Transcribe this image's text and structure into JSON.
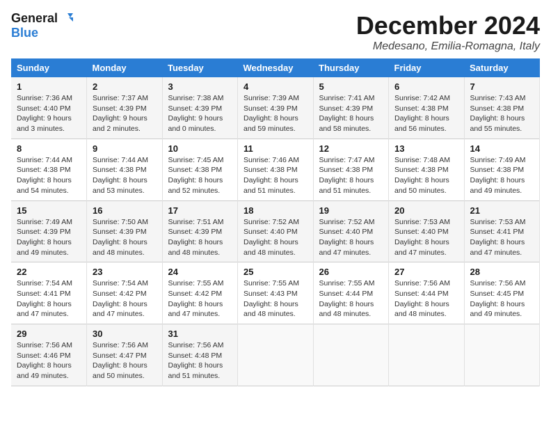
{
  "logo": {
    "line1": "General",
    "line2": "Blue"
  },
  "title": "December 2024",
  "subtitle": "Medesano, Emilia-Romagna, Italy",
  "weekdays": [
    "Sunday",
    "Monday",
    "Tuesday",
    "Wednesday",
    "Thursday",
    "Friday",
    "Saturday"
  ],
  "weeks": [
    [
      {
        "day": "1",
        "info": "Sunrise: 7:36 AM\nSunset: 4:40 PM\nDaylight: 9 hours\nand 3 minutes."
      },
      {
        "day": "2",
        "info": "Sunrise: 7:37 AM\nSunset: 4:39 PM\nDaylight: 9 hours\nand 2 minutes."
      },
      {
        "day": "3",
        "info": "Sunrise: 7:38 AM\nSunset: 4:39 PM\nDaylight: 9 hours\nand 0 minutes."
      },
      {
        "day": "4",
        "info": "Sunrise: 7:39 AM\nSunset: 4:39 PM\nDaylight: 8 hours\nand 59 minutes."
      },
      {
        "day": "5",
        "info": "Sunrise: 7:41 AM\nSunset: 4:39 PM\nDaylight: 8 hours\nand 58 minutes."
      },
      {
        "day": "6",
        "info": "Sunrise: 7:42 AM\nSunset: 4:38 PM\nDaylight: 8 hours\nand 56 minutes."
      },
      {
        "day": "7",
        "info": "Sunrise: 7:43 AM\nSunset: 4:38 PM\nDaylight: 8 hours\nand 55 minutes."
      }
    ],
    [
      {
        "day": "8",
        "info": "Sunrise: 7:44 AM\nSunset: 4:38 PM\nDaylight: 8 hours\nand 54 minutes."
      },
      {
        "day": "9",
        "info": "Sunrise: 7:44 AM\nSunset: 4:38 PM\nDaylight: 8 hours\nand 53 minutes."
      },
      {
        "day": "10",
        "info": "Sunrise: 7:45 AM\nSunset: 4:38 PM\nDaylight: 8 hours\nand 52 minutes."
      },
      {
        "day": "11",
        "info": "Sunrise: 7:46 AM\nSunset: 4:38 PM\nDaylight: 8 hours\nand 51 minutes."
      },
      {
        "day": "12",
        "info": "Sunrise: 7:47 AM\nSunset: 4:38 PM\nDaylight: 8 hours\nand 51 minutes."
      },
      {
        "day": "13",
        "info": "Sunrise: 7:48 AM\nSunset: 4:38 PM\nDaylight: 8 hours\nand 50 minutes."
      },
      {
        "day": "14",
        "info": "Sunrise: 7:49 AM\nSunset: 4:38 PM\nDaylight: 8 hours\nand 49 minutes."
      }
    ],
    [
      {
        "day": "15",
        "info": "Sunrise: 7:49 AM\nSunset: 4:39 PM\nDaylight: 8 hours\nand 49 minutes."
      },
      {
        "day": "16",
        "info": "Sunrise: 7:50 AM\nSunset: 4:39 PM\nDaylight: 8 hours\nand 48 minutes."
      },
      {
        "day": "17",
        "info": "Sunrise: 7:51 AM\nSunset: 4:39 PM\nDaylight: 8 hours\nand 48 minutes."
      },
      {
        "day": "18",
        "info": "Sunrise: 7:52 AM\nSunset: 4:40 PM\nDaylight: 8 hours\nand 48 minutes."
      },
      {
        "day": "19",
        "info": "Sunrise: 7:52 AM\nSunset: 4:40 PM\nDaylight: 8 hours\nand 47 minutes."
      },
      {
        "day": "20",
        "info": "Sunrise: 7:53 AM\nSunset: 4:40 PM\nDaylight: 8 hours\nand 47 minutes."
      },
      {
        "day": "21",
        "info": "Sunrise: 7:53 AM\nSunset: 4:41 PM\nDaylight: 8 hours\nand 47 minutes."
      }
    ],
    [
      {
        "day": "22",
        "info": "Sunrise: 7:54 AM\nSunset: 4:41 PM\nDaylight: 8 hours\nand 47 minutes."
      },
      {
        "day": "23",
        "info": "Sunrise: 7:54 AM\nSunset: 4:42 PM\nDaylight: 8 hours\nand 47 minutes."
      },
      {
        "day": "24",
        "info": "Sunrise: 7:55 AM\nSunset: 4:42 PM\nDaylight: 8 hours\nand 47 minutes."
      },
      {
        "day": "25",
        "info": "Sunrise: 7:55 AM\nSunset: 4:43 PM\nDaylight: 8 hours\nand 48 minutes."
      },
      {
        "day": "26",
        "info": "Sunrise: 7:55 AM\nSunset: 4:44 PM\nDaylight: 8 hours\nand 48 minutes."
      },
      {
        "day": "27",
        "info": "Sunrise: 7:56 AM\nSunset: 4:44 PM\nDaylight: 8 hours\nand 48 minutes."
      },
      {
        "day": "28",
        "info": "Sunrise: 7:56 AM\nSunset: 4:45 PM\nDaylight: 8 hours\nand 49 minutes."
      }
    ],
    [
      {
        "day": "29",
        "info": "Sunrise: 7:56 AM\nSunset: 4:46 PM\nDaylight: 8 hours\nand 49 minutes."
      },
      {
        "day": "30",
        "info": "Sunrise: 7:56 AM\nSunset: 4:47 PM\nDaylight: 8 hours\nand 50 minutes."
      },
      {
        "day": "31",
        "info": "Sunrise: 7:56 AM\nSunset: 4:48 PM\nDaylight: 8 hours\nand 51 minutes."
      },
      {
        "day": "",
        "info": ""
      },
      {
        "day": "",
        "info": ""
      },
      {
        "day": "",
        "info": ""
      },
      {
        "day": "",
        "info": ""
      }
    ]
  ]
}
